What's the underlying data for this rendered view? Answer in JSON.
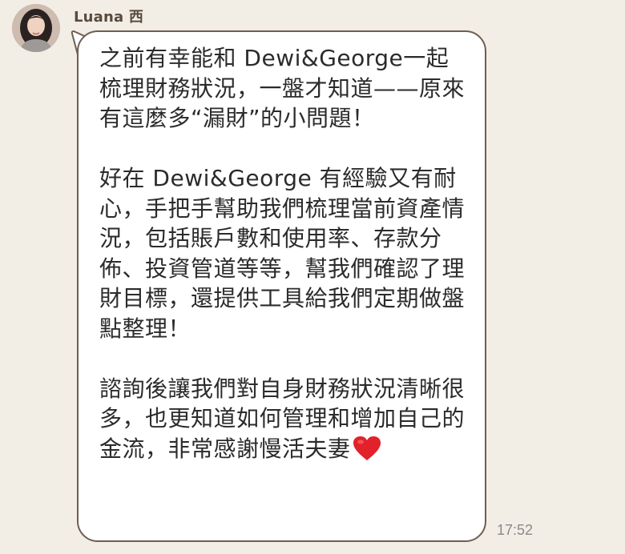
{
  "sender": {
    "name": "Luana 西",
    "avatar_icon": "profile-photo"
  },
  "message": {
    "text": "之前有幸能和 Dewi&George一起梳理財務狀況，一盤才知道——原來有這麼多“漏財”的小問題！\n\n好在 Dewi&George 有經驗又有耐心，手把手幫助我們梳理當前資產情況，包括賬戶數和使用率、存款分佈、投資管道等等，幫我們確認了理財目標，還提供工具給我們定期做盤點整理！\n\n諮詢後讓我們對自身財務狀況清晰很多，也更知道如何管理和增加自己的金流，非常感謝慢活夫妻",
    "emoji": "red-heart-icon",
    "timestamp": "17:52"
  },
  "colors": {
    "background": "#F2EEE6",
    "bubble_fill": "#FFFFFF",
    "bubble_border": "#6E5E52",
    "name_color": "#5A4A3E",
    "heart": "#E2212B"
  }
}
